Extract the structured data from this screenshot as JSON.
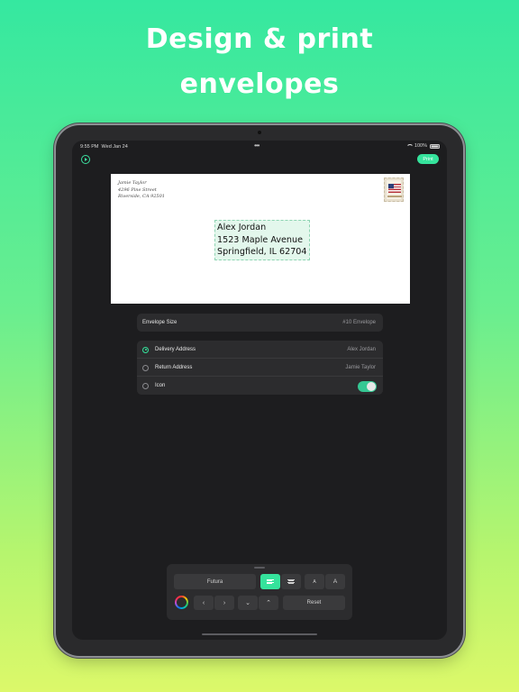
{
  "headline": {
    "line1": "Design & print",
    "line2": "envelopes"
  },
  "status_bar": {
    "time": "9:55 PM",
    "date": "Wed Jan 24",
    "battery": "100%"
  },
  "toolbar_top": {
    "print_label": "Print"
  },
  "envelope": {
    "return_address": [
      "Jamie Taylor",
      "4296 Pine Street",
      "Riverside, CA 92501"
    ],
    "delivery_address": [
      "Alex Jordan",
      "1523 Maple Avenue",
      "Springfield, IL 62704"
    ]
  },
  "settings": {
    "envelope_size_label": "Envelope Size",
    "envelope_size_value": "#10 Envelope",
    "options": [
      {
        "label": "Delivery Address",
        "value": "Alex Jordan",
        "selected": true
      },
      {
        "label": "Return Address",
        "value": "Jamie Taylor",
        "selected": false
      },
      {
        "label": "Icon",
        "toggle_on": true,
        "selected": false
      }
    ]
  },
  "format_toolbar": {
    "font": "Futura",
    "size_down": "A",
    "size_up": "A",
    "move_left": "‹",
    "move_right": "›",
    "move_down": "⌄",
    "move_up": "⌃",
    "reset": "Reset"
  },
  "colors": {
    "accent": "#35e39c",
    "background_top": "#35e8a0",
    "background_bottom": "#dcf86a"
  }
}
